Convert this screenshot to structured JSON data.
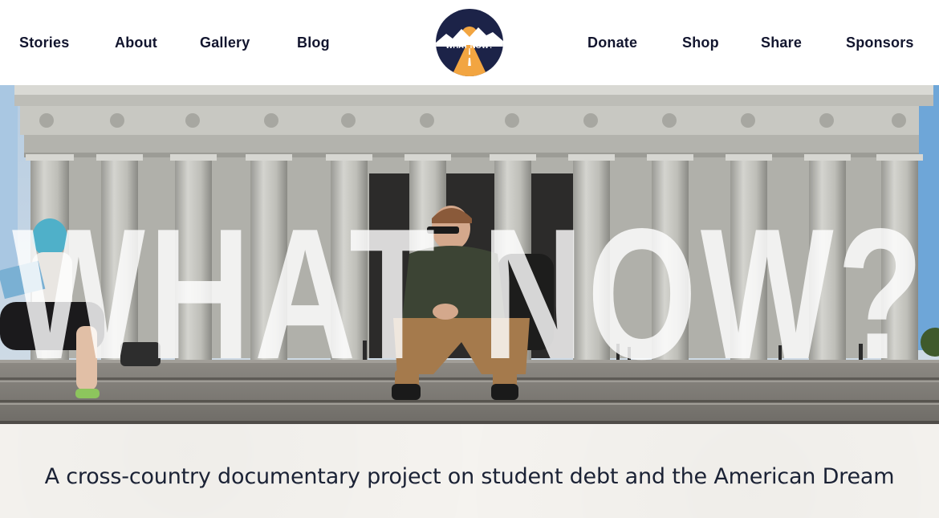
{
  "nav": {
    "left": [
      {
        "label": "Stories"
      },
      {
        "label": "About"
      },
      {
        "label": "Gallery"
      },
      {
        "label": "Blog"
      }
    ],
    "right": [
      {
        "label": "Donate"
      },
      {
        "label": "Shop"
      },
      {
        "label": "Share"
      },
      {
        "label": "Sponsors"
      }
    ]
  },
  "logo": {
    "text": "WHAT NOW?",
    "icon": "road-mountain-logo-icon"
  },
  "hero": {
    "title": "WHAT NOW?"
  },
  "tagline": "A cross-country documentary project on student debt and the American Dream",
  "colors": {
    "nav_text": "#12152e",
    "logo_circle": "#1c2348",
    "logo_road": "#f2a541",
    "tagline_bg": "#f5f3ef",
    "tagline_text": "#1b2235"
  }
}
